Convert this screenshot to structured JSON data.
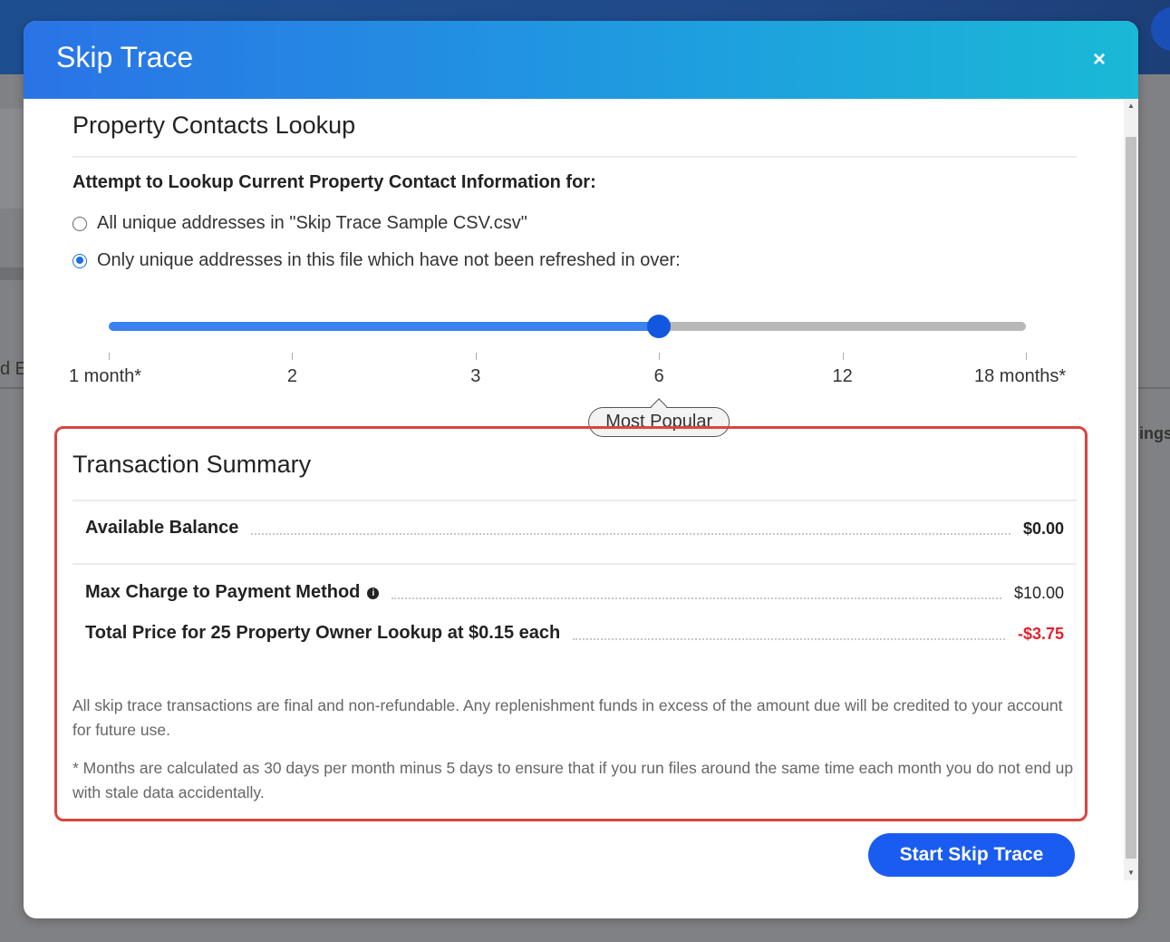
{
  "background": {
    "left_fragment": "d E",
    "right_fragment": "ings"
  },
  "modal": {
    "title": "Skip Trace",
    "close_icon": "×"
  },
  "lookup": {
    "section_title": "Property Contacts Lookup",
    "question": "Attempt to Lookup Current Property Contact Information for:",
    "options": [
      {
        "label": "All unique addresses in \"Skip Trace Sample CSV.csv\"",
        "checked": false
      },
      {
        "label": "Only unique addresses in this file which have not been refreshed in over:",
        "checked": true
      }
    ]
  },
  "slider": {
    "ticks": [
      "1 month*",
      "2",
      "3",
      "6",
      "12",
      "18 months*"
    ],
    "selected_index": 3,
    "selected_label": "6",
    "badge": "Most Popular",
    "fill_color": "#3b82f0",
    "thumb_color": "#1157df"
  },
  "summary": {
    "title": "Transaction Summary",
    "available_balance_label": "Available Balance",
    "available_balance_value": "$0.00",
    "max_charge_label": "Max Charge to Payment Method",
    "max_charge_icon": "info-icon",
    "max_charge_value": "$10.00",
    "total_label": "Total Price for 25 Property Owner Lookup at $0.15 each",
    "total_value": "-$3.75",
    "note1": "All skip trace transactions are final and non-refundable. Any replenishment funds in excess of the amount due will be credited to your account for future use.",
    "note2": "* Months are calculated as 30 days per month minus 5 days to ensure that if you run files around the same time each month you do not end up with stale data accidentally.",
    "highlight_color": "#d9463f",
    "negative_color": "#e0242e"
  },
  "actions": {
    "start_label": "Start Skip Trace"
  }
}
